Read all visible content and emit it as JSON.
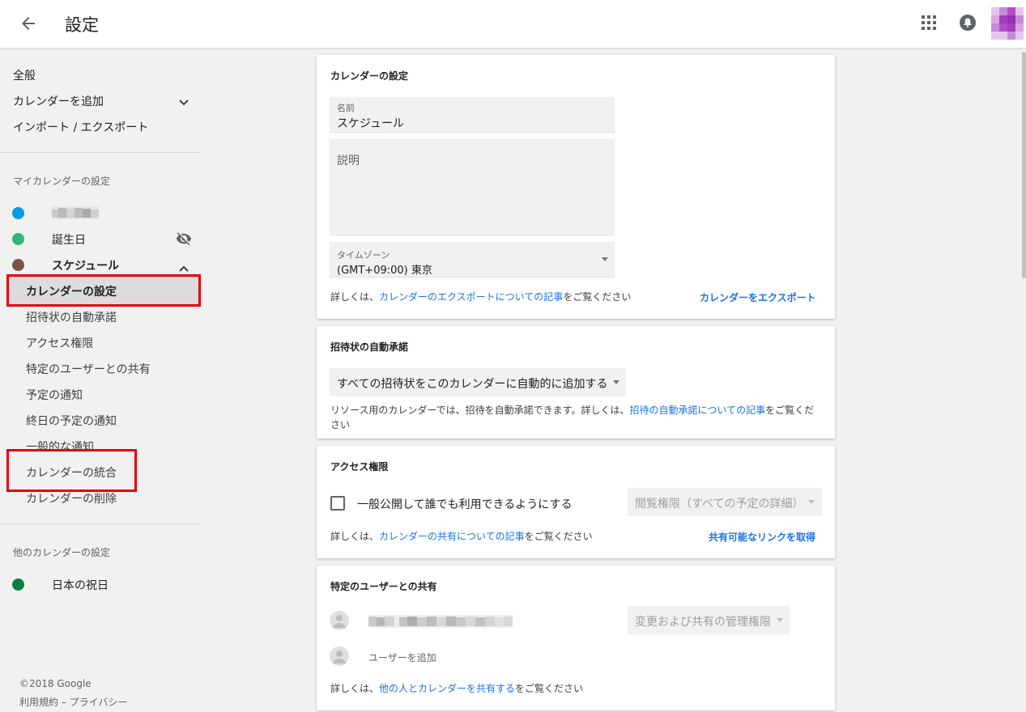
{
  "header": {
    "title": "設定"
  },
  "sidebar": {
    "top_items": [
      "全般",
      "カレンダーを追加",
      "インポート / エクスポート"
    ],
    "my_calendars_label": "マイカレンダーの設定",
    "my_calendars": [
      {
        "name": "",
        "color": "#039be5"
      },
      {
        "name": "誕生日",
        "color": "#33b679"
      },
      {
        "name": "スケジュール",
        "color": "#795548"
      }
    ],
    "schedule_subitems": [
      "カレンダーの設定",
      "招待状の自動承諾",
      "アクセス権限",
      "特定のユーザーとの共有",
      "予定の通知",
      "終日の予定の通知",
      "一般的な通知",
      "カレンダーの統合",
      "カレンダーの削除"
    ],
    "other_calendars_label": "他のカレンダーの設定",
    "other_calendars": [
      {
        "name": "日本の祝日",
        "color": "#0b8043"
      }
    ],
    "footer": {
      "copyright": "©2018 Google",
      "terms": "利用規約",
      "separator": " – ",
      "privacy": "プライバシー"
    }
  },
  "calendar_settings": {
    "title": "カレンダーの設定",
    "name_label": "名前",
    "name_value": "スケジュール",
    "description_label": "説明",
    "timezone_label": "タイムゾーン",
    "timezone_value": "(GMT+09:00) 東京",
    "info_prefix": "詳しくは、",
    "info_link": "カレンダーのエクスポートについての記事",
    "info_suffix": "をご覧ください",
    "export_link": "カレンダーをエクスポート"
  },
  "auto_accept": {
    "title": "招待状の自動承諾",
    "select_value": "すべての招待状をこのカレンダーに自動的に追加する",
    "info_prefix": "リソース用のカレンダーでは、招待を自動承諾できます。詳しくは、",
    "info_link": "招待の自動承諾についての記事",
    "info_suffix": "をご覧くだ",
    "info_suffix2": "さい"
  },
  "access": {
    "title": "アクセス権限",
    "public_label": "一般公開して誰でも利用できるようにする",
    "permission_value": "閲覧権限（すべての予定の詳細）",
    "info_prefix": "詳しくは、",
    "info_link": "カレンダーの共有についての記事",
    "info_suffix": "をご覧ください",
    "share_link": "共有可能なリンクを取得"
  },
  "sharing": {
    "title": "特定のユーザーとの共有",
    "permission_value": "変更および共有の管理権限",
    "add_user": "ユーザーを追加",
    "info_prefix": "詳しくは、",
    "info_link": "他の人とカレンダーを共有する",
    "info_suffix": "をご覧ください"
  },
  "colors": {
    "highlight_border": "#e8000b",
    "link": "#1a73e8",
    "avatar": "#b04fc4"
  }
}
